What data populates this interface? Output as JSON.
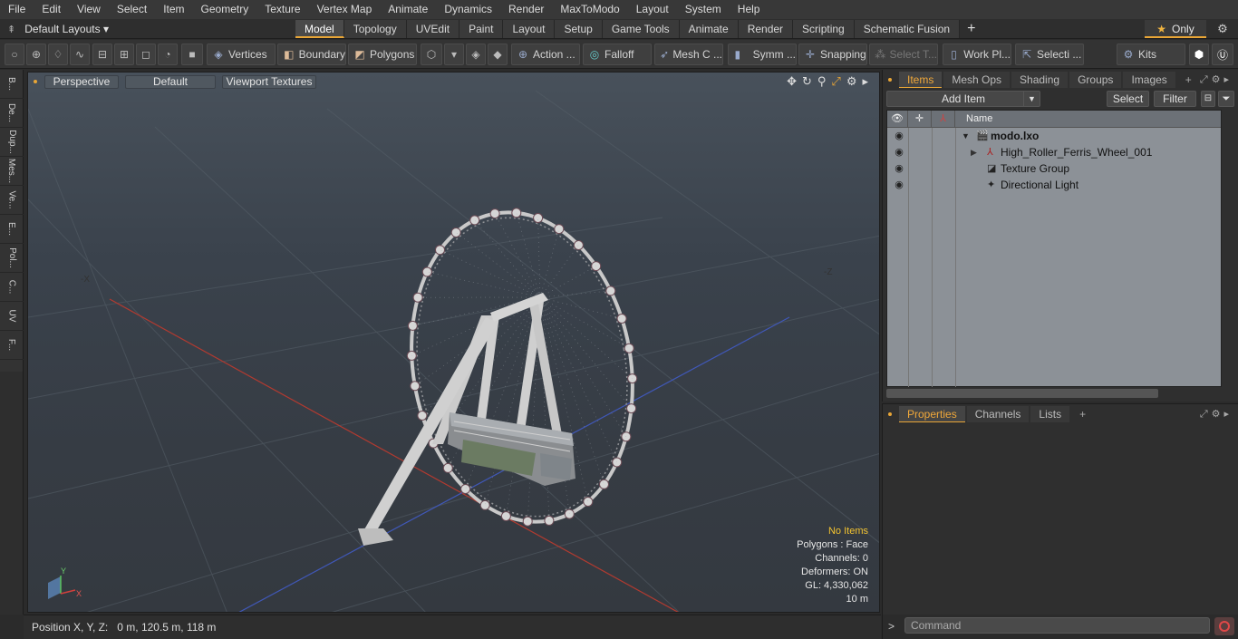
{
  "menu": [
    "File",
    "Edit",
    "View",
    "Select",
    "Item",
    "Geometry",
    "Texture",
    "Vertex Map",
    "Animate",
    "Dynamics",
    "Render",
    "MaxToModo",
    "Layout",
    "System",
    "Help"
  ],
  "layouts": {
    "label": "Default Layouts ▾"
  },
  "tabs": [
    "Model",
    "Topology",
    "UVEdit",
    "Paint",
    "Layout",
    "Setup",
    "Game Tools",
    "Animate",
    "Render",
    "Scripting",
    "Schematic Fusion"
  ],
  "active_tab": "Model",
  "only_label": "Only",
  "toolbar": {
    "vertices": "Vertices",
    "boundary": "Boundary",
    "polygons": "Polygons",
    "action": "Action ...",
    "falloff": "Falloff",
    "mesh": "Mesh C ...",
    "symm": "Symm ...",
    "snapping": "Snapping",
    "select_t": "Select T...",
    "workpl": "Work Pl...",
    "selecti": "Selecti ...",
    "kits": "Kits"
  },
  "left_tabs": [
    "B...",
    "De...",
    "Dup...",
    "Mes...",
    "Ve...",
    "E...",
    "Pol...",
    "C...",
    "UV",
    "F..."
  ],
  "viewport": {
    "view": "Perspective",
    "shading": "Default",
    "textures": "Viewport Textures",
    "info": {
      "selection": "No Items",
      "polygons": "Polygons : Face",
      "channels": "Channels: 0",
      "deformers": "Deformers: ON",
      "gl": "GL: 4,330,062",
      "scale": "10 m"
    },
    "axis_labels": {
      "x": "X",
      "y": "Y",
      "z": "Z",
      "neg_x": "-X",
      "neg_z": "-Z"
    }
  },
  "status": {
    "position": "Position X, Y, Z:   0 m, 120.5 m, 118 m"
  },
  "items_panel": {
    "tabs": [
      "Items",
      "Mesh Ops",
      "Shading",
      "Groups",
      "Images"
    ],
    "add_item": "Add Item",
    "select": "Select",
    "filter": "Filter",
    "name_header": "Name",
    "tree": [
      {
        "label": "modo.lxo",
        "level": 0,
        "bold": true,
        "icon": "scene-icon"
      },
      {
        "label": "High_Roller_Ferris_Wheel_001",
        "level": 1,
        "bold": false,
        "icon": "mesh-icon"
      },
      {
        "label": "Texture Group",
        "level": 1,
        "bold": false,
        "icon": "texture-group-icon"
      },
      {
        "label": "Directional Light",
        "level": 1,
        "bold": false,
        "icon": "light-icon"
      }
    ]
  },
  "properties_panel": {
    "tabs": [
      "Properties",
      "Channels",
      "Lists"
    ]
  },
  "command": {
    "placeholder": "Command"
  },
  "colors": {
    "accent": "#e9a636",
    "info_highlight": "#f2c230",
    "grid_x": "#c0392b",
    "grid_z": "#3b5cc0"
  }
}
